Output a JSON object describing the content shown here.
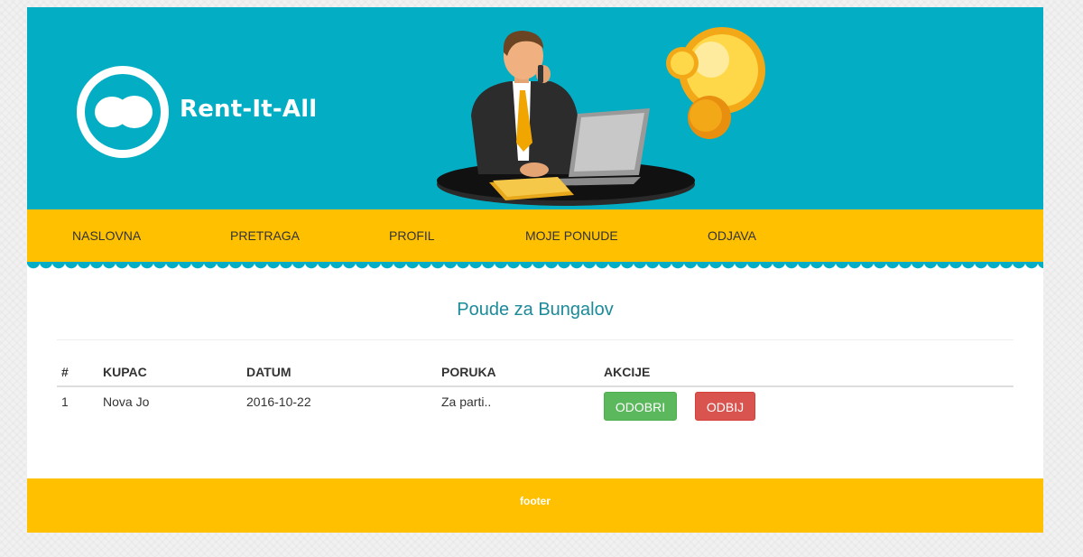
{
  "brand": {
    "name": "Rent-It-All"
  },
  "nav": {
    "items": [
      {
        "label": "NASLOVNA"
      },
      {
        "label": "PRETRAGA"
      },
      {
        "label": "PROFIL"
      },
      {
        "label": "MOJE PONUDE"
      },
      {
        "label": "ODJAVA"
      }
    ]
  },
  "main": {
    "title": "Poude za Bungalov",
    "table": {
      "headers": [
        "#",
        "KUPAC",
        "DATUM",
        "PORUKA",
        "AKCIJE"
      ],
      "rows": [
        {
          "num": "1",
          "buyer": "Nova Jo",
          "date": "2016-10-22",
          "message": "Za parti.."
        }
      ],
      "actions": {
        "approve": "ODOBRI",
        "reject": "ODBIJ"
      }
    }
  },
  "footer": {
    "text": "footer"
  },
  "colors": {
    "header_bg": "#03aec4",
    "nav_bg": "#ffc000",
    "approve": "#5cb85c",
    "reject": "#d9534f",
    "title": "#1b8a99"
  }
}
